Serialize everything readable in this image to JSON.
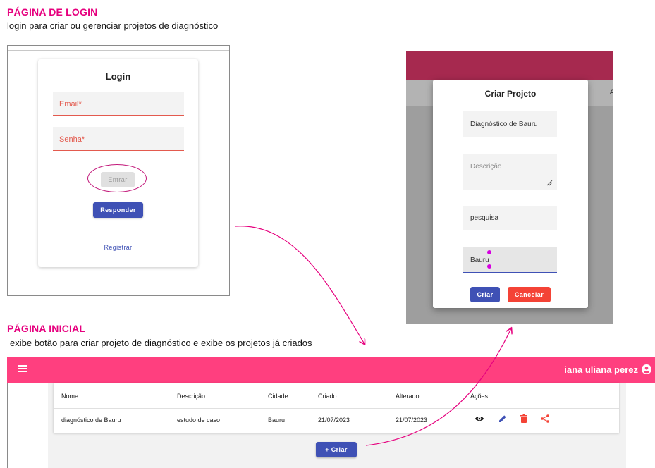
{
  "login_section": {
    "title": "PÁGINA DE LOGIN",
    "subtitle": "login para criar ou gerenciar projetos de diagnóstico",
    "card_title": "Login",
    "email_label": "Email*",
    "password_label": "Senha*",
    "enter_button": "Entrar",
    "respond_button": "Responder",
    "register_link": "Registrar"
  },
  "create_modal": {
    "title": "Criar Projeto",
    "name_value": "Diagnóstico de Bauru",
    "description_placeholder": "Descrição",
    "type_value": "pesquisa",
    "city_value": "Bauru",
    "create_button": "Criar",
    "cancel_button": "Cancelar",
    "background_strip_text": "A"
  },
  "home_section": {
    "title": "PÁGINA INICIAL",
    "subtitle": "exibe botão para criar projeto de diagnóstico e exibe os projetos já criados",
    "user_name": "iana uliana perez",
    "create_button": "+ Criar",
    "table": {
      "headers": [
        "Nome",
        "Descrição",
        "Cidade",
        "Criado",
        "Alterado",
        "Ações"
      ],
      "rows": [
        [
          "diagnóstico de Bauru",
          "estudo de caso",
          "Bauru",
          "21/07/2023",
          "21/07/2023"
        ]
      ]
    },
    "action_icons": [
      "eye-icon",
      "edit-icon",
      "delete-icon",
      "share-icon"
    ]
  },
  "colors": {
    "accent_pink": "#e6007e",
    "app_bar_pink": "#ff3f7f",
    "primary_blue": "#3f51b5",
    "danger_red": "#f44336",
    "error_red": "#e35a4e"
  }
}
